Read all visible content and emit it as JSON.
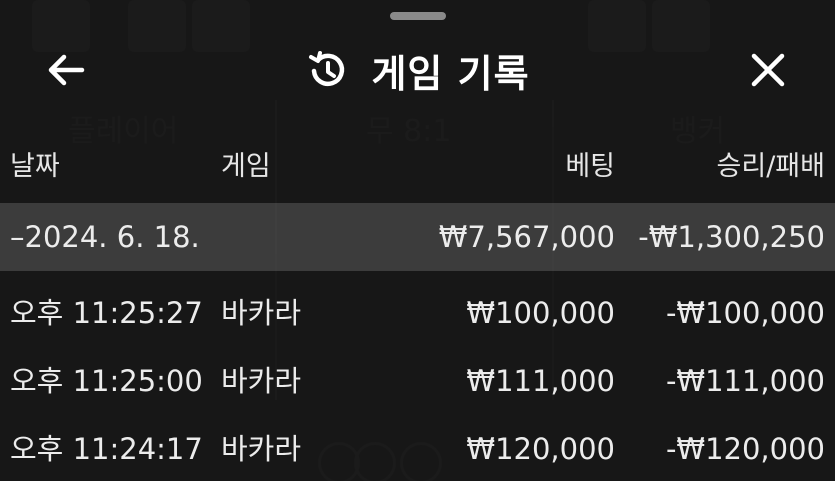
{
  "header": {
    "title": "게임 기록"
  },
  "icons": {
    "back": "arrow-left-icon",
    "history": "history-clock-icon",
    "close": "close-x-icon"
  },
  "background": {
    "player_label": "플레이어",
    "tie_label": "무 8:1",
    "banker_label": "뱅커"
  },
  "columns": {
    "date": "날짜",
    "game": "게임",
    "bet": "베팅",
    "result": "승리/패배"
  },
  "date_group": {
    "date": "–2024. 6. 18.",
    "bet_total": "₩7,567,000",
    "result_total": "-₩1,300,250"
  },
  "rows": [
    {
      "time": "오후 11:25:27",
      "game": "바카라",
      "bet": "₩100,000",
      "result": "-₩100,000"
    },
    {
      "time": "오후 11:25:00",
      "game": "바카라",
      "bet": "₩111,000",
      "result": "-₩111,000"
    },
    {
      "time": "오후 11:24:17",
      "game": "바카라",
      "bet": "₩120,000",
      "result": "-₩120,000"
    }
  ],
  "colors": {
    "panel_bg": "#161616",
    "text": "#ececec",
    "date_row_bg": "#3a3a3a"
  }
}
